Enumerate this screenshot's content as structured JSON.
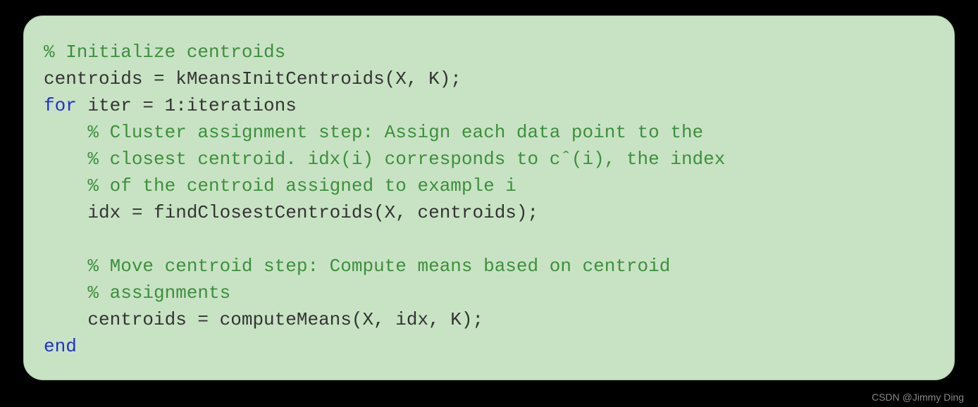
{
  "code": {
    "line1_comment": "% Initialize centroids",
    "line2": "centroids = kMeansInitCentroids(X, K);",
    "line3_kw": "for",
    "line3_rest": " iter = 1:iterations",
    "line4_comment": "    % Cluster assignment step: Assign each data point to the",
    "line5_comment": "    % closest centroid. idx(i) corresponds to cˆ(i), the index",
    "line6_comment": "    % of the centroid assigned to example i",
    "line7": "    idx = findClosestCentroids(X, centroids);",
    "blank": "",
    "line9_comment": "    % Move centroid step: Compute means based on centroid",
    "line10_comment": "    % assignments",
    "line11": "    centroids = computeMeans(X, idx, K);",
    "line12_kw": "end"
  },
  "watermark": "CSDN @Jimmy Ding"
}
